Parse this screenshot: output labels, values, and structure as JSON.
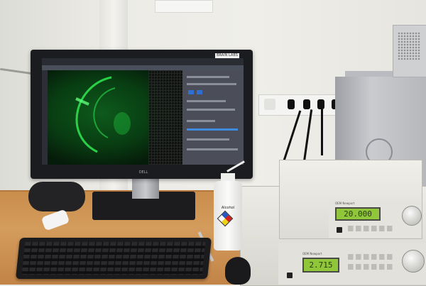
{
  "scene": {
    "monitor": {
      "brand": "DELL",
      "corner_label": "BRAIN LABS",
      "screen_app": "microscopy-imaging-software",
      "screen_content": "green-fluorescence-image"
    },
    "bottle": {
      "label": "Alcohol"
    },
    "controller_top": {
      "brand_label": "OEM Newport",
      "display_value": "20.000"
    },
    "controller_bottom": {
      "brand_label": "OEM Newport",
      "display_value": "2.715"
    },
    "icons": {
      "hazard": "nfpa-diamond-icon",
      "knob": "rotary-knob-icon",
      "power": "power-switch-icon"
    },
    "colors": {
      "fluorescence": "#2ee04e",
      "lcd": "#8fc63a",
      "desk": "#d49c5c"
    }
  }
}
